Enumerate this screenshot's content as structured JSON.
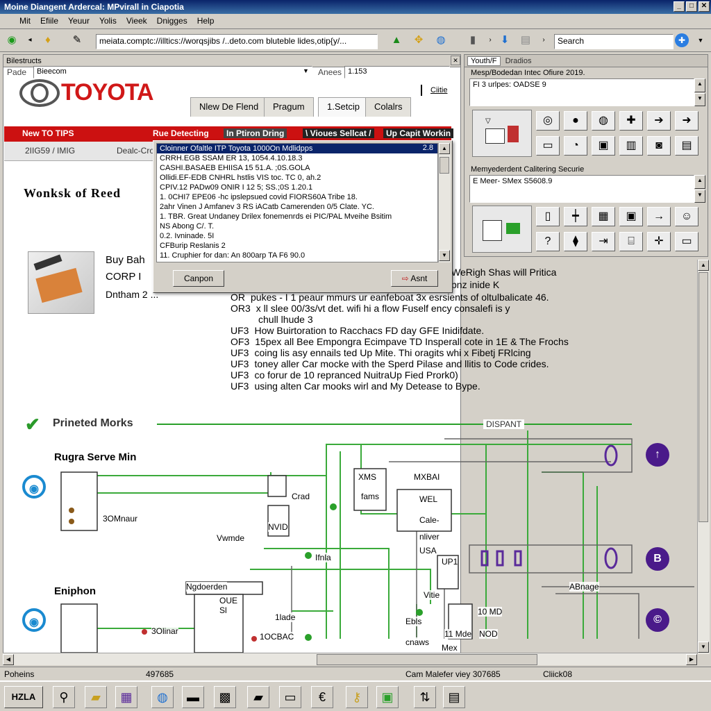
{
  "window": {
    "title": "Moine Diangent Ardercal: MPvirall in Ciapotia"
  },
  "menu": [
    "Mit",
    "Efiile",
    "Yeuur",
    "Yolis",
    "Vieek",
    "Dnigges",
    "Help"
  ],
  "toolbar": {
    "address": "meiata.comptc://illtics://worqsjibs /..deto.com bluteble lides,otip{y/...",
    "search_placeholder": "Search"
  },
  "left_panel": {
    "header": "Bilestructs",
    "row_label": "Pade",
    "row_value": "Bieecom",
    "row_right_label": "Anees",
    "row_right_value": "1.153"
  },
  "brand": {
    "name": "TOYOTA",
    "right_text": "Ciitie"
  },
  "tabs": [
    "Nlew De Flend",
    "Pragum",
    "1.Setcip",
    "Colalrs"
  ],
  "redbar": [
    "New TO TIPS",
    "Rue Detecting",
    "In Ptiron Dring",
    "\\ Vioues Sellcat /",
    "Up Capit Workin"
  ],
  "subheader": {
    "left": "2IIG59 / IMIG",
    "right": "Dealc-Cro"
  },
  "heading": "Wonksk of Reed",
  "product": {
    "line1": "Buy Bah",
    "line2": "CORP I",
    "line3": "Dntham 2 ..."
  },
  "dialog": {
    "items": [
      "Cloinner Ofaltle ITP Toyota 1000On Mdlidpps",
      "CRRH.EGB SSAM ER 13, 1054.4.10.18.3",
      "CASHI.BASAEB EHIISA 15 51.A. ;0S.GOLA",
      "Ollidi.EF-EDB CNHRL hstlis VIS toc. TC 0, ah.2",
      "CPIV.12 PADw09 ONIR I 12 5; SS.;0S 1.20.1",
      "1. 0CHI7 EPE06 -hc ipslepsued covid FIORS60A Tribe 18.",
      "2ahr Vinen J Amfanev 3 RS iACatb Camerenden 0/5 Clate. YC.",
      "1. TBR. Great Undaney Drilex fonemenrds ei PIC/PAL Mveihe Bsitim",
      "NS Abong C/. T.",
      "0.2. Ivninade. 5I",
      "CFBurip Reslanis 2",
      "11. Cruphier for dan: An 800arp TA F6 90.0"
    ],
    "item0_right": "2.8",
    "cancel": "Canpon",
    "ok": "Asnt"
  },
  "body_lines": [
    {
      "bullet": "",
      "text": "WeRigh Shas will Pritica"
    },
    {
      "bullet": "",
      "text": "pnz inide K"
    },
    {
      "bullet": "OR",
      "text": "pukes - I 1 peaur mmurs ur eanfeboat 3x esrsients of oltulbalicate 46."
    },
    {
      "bullet": "OR3",
      "text": "x ll slee 00/3s/vt det. wifi hi a flow Fuself ency consalefi is y"
    },
    {
      "bullet": "",
      "text": "chull lhude 3"
    },
    {
      "bullet": "UF3",
      "text": "How Buirtoration to Racchacs FD day GFE Inidifdate."
    },
    {
      "bullet": "OF3",
      "text": "15pex all Bee Empongra Ecimpave TD Insperall cote in 1E & The Frochs"
    },
    {
      "bullet": "UF3",
      "text": "coing lis asy ennails ted Up Mite. Thi oragits whi x Fibetj FRlcing"
    },
    {
      "bullet": "UF3",
      "text": "toney aller Car mocke with the Sperd Pilase and llitis to Code crides."
    },
    {
      "bullet": "UF3",
      "text": "co forur de 10 repranced NuitraUp Fied Prork0)"
    },
    {
      "bullet": "UF3",
      "text": "using alten Car mooks wirl and My Detease to Bype."
    }
  ],
  "diagram": {
    "section_title": "Prineted Morks",
    "section_right": "DISPANT",
    "row1_title": "Rugra Serve Min",
    "row2_title": "Eniphon",
    "labels": [
      "3OMnaur",
      "Vwmde",
      "Ifnla",
      "Crad",
      "NVID",
      "XMS",
      "fams",
      "MXBAI",
      "WEL",
      "Cale-",
      "nliver",
      "USA",
      "UP1",
      "ABnage",
      "Vitie",
      "Ngdoerden",
      "OUE",
      "Sl",
      "1lade",
      "3Olinar",
      "1OCBAC",
      "10 MD",
      "NOD",
      "Ebls",
      "cnaws",
      "Mex",
      "11 Mde"
    ]
  },
  "right_panel": {
    "tabs": [
      "Youth/F",
      "Dradios"
    ],
    "label1": "Mesp/Bodedan Intec Ofiure 2019.",
    "field1": "FI 3 urlpes: OADSE 9",
    "label2": "Memyederdent Calitering Securie",
    "field2": "E Meer- SMex S5608.9"
  },
  "statusbar": {
    "left": "Poheins",
    "mid": "497685",
    "mid2": "Cam Malefer viey 307685",
    "right": "Cliick08"
  },
  "taskbar": {
    "start": "HZLA"
  }
}
